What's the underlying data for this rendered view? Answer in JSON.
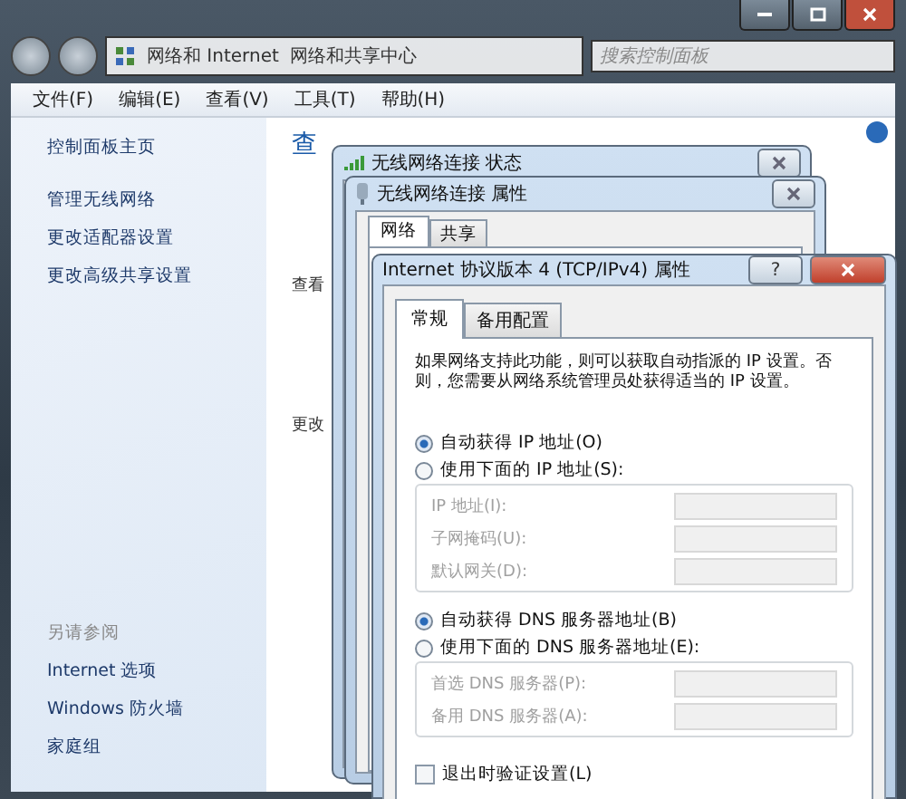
{
  "explorer": {
    "breadcrumb": [
      {
        "label": "网络和 Internet"
      },
      {
        "label": "网络和共享中心"
      }
    ],
    "search": {
      "placeholder": "搜索控制面板"
    },
    "menu": [
      {
        "label": "文件(F)"
      },
      {
        "label": "编辑(E)"
      },
      {
        "label": "查看(V)"
      },
      {
        "label": "工具(T)"
      },
      {
        "label": "帮助(H)"
      }
    ],
    "sidebar": {
      "items": [
        {
          "label": "控制面板主页"
        },
        {
          "label": "管理无线网络"
        },
        {
          "label": "更改适配器设置"
        },
        {
          "label": "更改高级共享设置"
        }
      ],
      "see_also": {
        "heading": "另请参阅",
        "items": [
          {
            "label": "Internet 选项"
          },
          {
            "label": "Windows 防火墙"
          },
          {
            "label": "家庭组"
          }
        ]
      }
    },
    "content": {
      "heading": "查",
      "lines": [
        {
          "text": "查看"
        },
        {
          "text": "更改"
        }
      ]
    }
  },
  "status_dialog": {
    "title": "无线网络连接 状态"
  },
  "properties_dialog": {
    "title": "无线网络连接 属性",
    "tabs": [
      {
        "label": "网络",
        "selected": true
      },
      {
        "label": "共享",
        "selected": false
      }
    ]
  },
  "ipv4_dialog": {
    "title": "Internet 协议版本 4 (TCP/IPv4) 属性",
    "help": "?",
    "tabs": [
      {
        "label": "常规",
        "selected": true
      },
      {
        "label": "备用配置",
        "selected": false
      }
    ],
    "intro": "如果网络支持此功能，则可以获取自动指派的 IP 设置。否则，您需要从网络系统管理员处获得适当的 IP 设置。",
    "ip_options": [
      {
        "label": "自动获得 IP 地址(O)",
        "selected": true
      },
      {
        "label": "使用下面的 IP 地址(S):",
        "selected": false
      }
    ],
    "ip_fields": [
      {
        "label": "IP 地址(I):",
        "disabled": true
      },
      {
        "label": "子网掩码(U):",
        "disabled": true
      },
      {
        "label": "默认网关(D):",
        "disabled": true
      }
    ],
    "dns_options": [
      {
        "label": "自动获得 DNS 服务器地址(B)",
        "selected": true
      },
      {
        "label": "使用下面的 DNS 服务器地址(E):",
        "selected": false
      }
    ],
    "dns_fields": [
      {
        "label": "首选 DNS 服务器(P):",
        "disabled": true
      },
      {
        "label": "备用 DNS 服务器(A):",
        "disabled": true
      }
    ],
    "validate": {
      "label": "退出时验证设置(L)",
      "checked": false
    }
  }
}
